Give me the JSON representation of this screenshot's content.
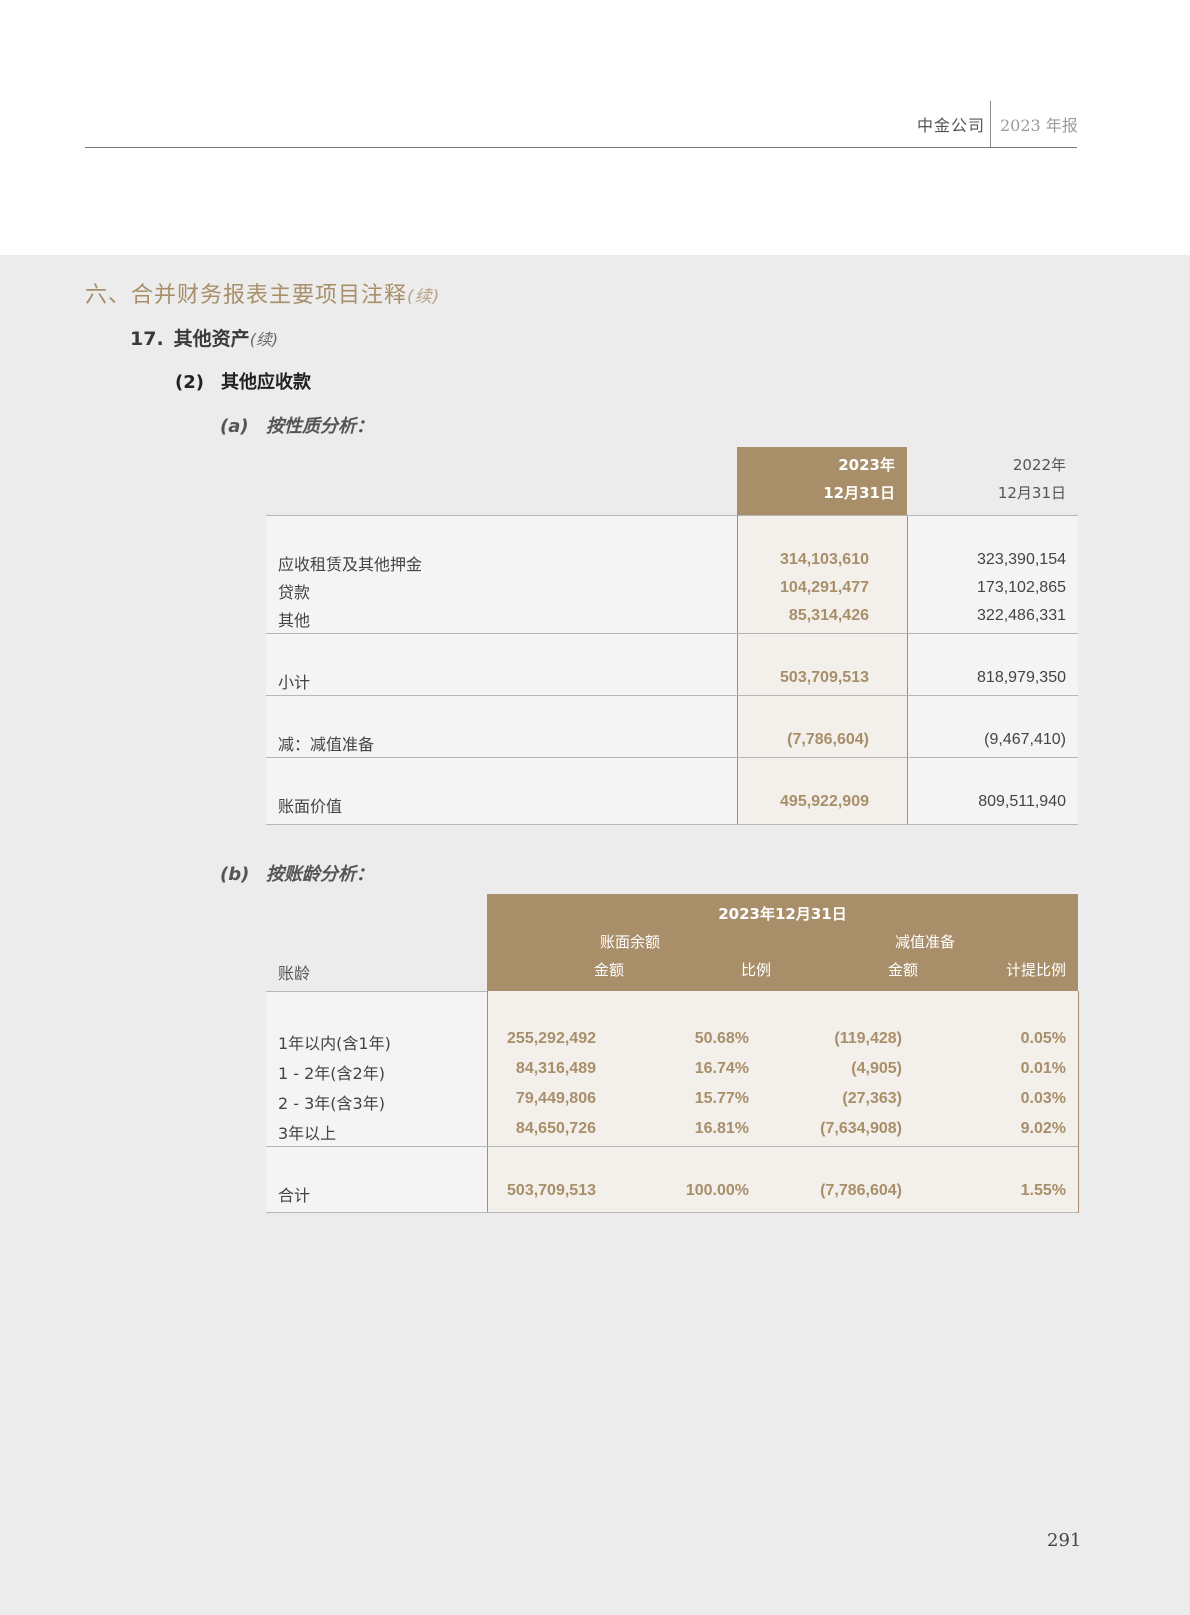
{
  "header": {
    "company": "中金公司",
    "report": "2023 年报"
  },
  "section": {
    "title": "六、合并财务报表主要项目注释",
    "continued": "(续)"
  },
  "note": {
    "number": "17.",
    "title": "其他资产",
    "continued": "(续)"
  },
  "sub": {
    "number": "(2)",
    "title": "其他应收款"
  },
  "table_a": {
    "number": "(a)",
    "title": "按性质分析：",
    "head_2023_line1": "2023年",
    "head_2023_line2": "12月31日",
    "head_2022_line1": "2022年",
    "head_2022_line2": "12月31日",
    "rows": [
      {
        "label": "应收租赁及其他押金",
        "v2023": "314,103,610",
        "v2022": "323,390,154"
      },
      {
        "label": "贷款",
        "v2023": "104,291,477",
        "v2022": "173,102,865"
      },
      {
        "label": "其他",
        "v2023": "85,314,426",
        "v2022": "322,486,331"
      },
      {
        "label": "小计",
        "v2023": "503,709,513",
        "v2022": "818,979,350"
      },
      {
        "label": "减：减值准备",
        "v2023": "(7,786,604)",
        "v2022": "(9,467,410)"
      },
      {
        "label": "账面价值",
        "v2023": "495,922,909",
        "v2022": "809,511,940"
      }
    ]
  },
  "table_b": {
    "number": "(b)",
    "title": "按账龄分析：",
    "head_date": "2023年12月31日",
    "head_balance": "账面余额",
    "head_provision": "减值准备",
    "head_amount1": "金额",
    "head_ratio": "比例",
    "head_amount2": "金额",
    "head_prov_ratio": "计提比例",
    "head_age": "账龄",
    "rows": [
      {
        "label": "1年以内(含1年)",
        "amount": "255,292,492",
        "ratio": "50.68%",
        "provision": "(119,428)",
        "prov_ratio": "0.05%"
      },
      {
        "label": "1 - 2年(含2年)",
        "amount": "84,316,489",
        "ratio": "16.74%",
        "provision": "(4,905)",
        "prov_ratio": "0.01%"
      },
      {
        "label": "2 - 3年(含3年)",
        "amount": "79,449,806",
        "ratio": "15.77%",
        "provision": "(27,363)",
        "prov_ratio": "0.03%"
      },
      {
        "label": "3年以上",
        "amount": "84,650,726",
        "ratio": "16.81%",
        "provision": "(7,634,908)",
        "prov_ratio": "9.02%"
      },
      {
        "label": "合计",
        "amount": "503,709,513",
        "ratio": "100.00%",
        "provision": "(7,786,604)",
        "prov_ratio": "1.55%"
      }
    ]
  },
  "page_number": "291"
}
